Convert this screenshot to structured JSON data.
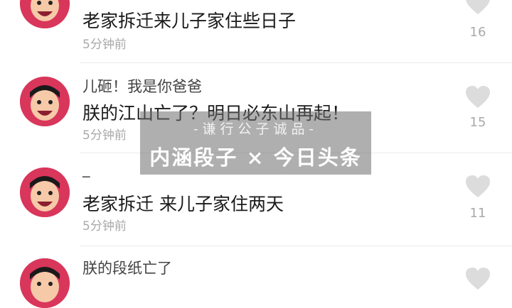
{
  "comments": [
    {
      "username": "",
      "content": "老家拆迁来儿子家住些日子",
      "time": "5分钟前",
      "likes": "16"
    },
    {
      "username": "儿砸！我是你爸爸",
      "content": "朕的江山亡了？明日必东山再起！",
      "time": "5分钟前",
      "likes": "15"
    },
    {
      "username": "_",
      "content": "老家拆迁 来儿子家住两天",
      "time": "5分钟前",
      "likes": "11"
    },
    {
      "username": "朕的段纸亡了",
      "content": "",
      "time": "",
      "likes": ""
    }
  ],
  "watermark": {
    "tagline": "-谦行公子诚品-",
    "title": "内涵段子 × 今日头条"
  },
  "colors": {
    "avatar_bg": "#d9365b",
    "heart": "#dcdcdc",
    "meta_text": "#a9a9a9"
  }
}
